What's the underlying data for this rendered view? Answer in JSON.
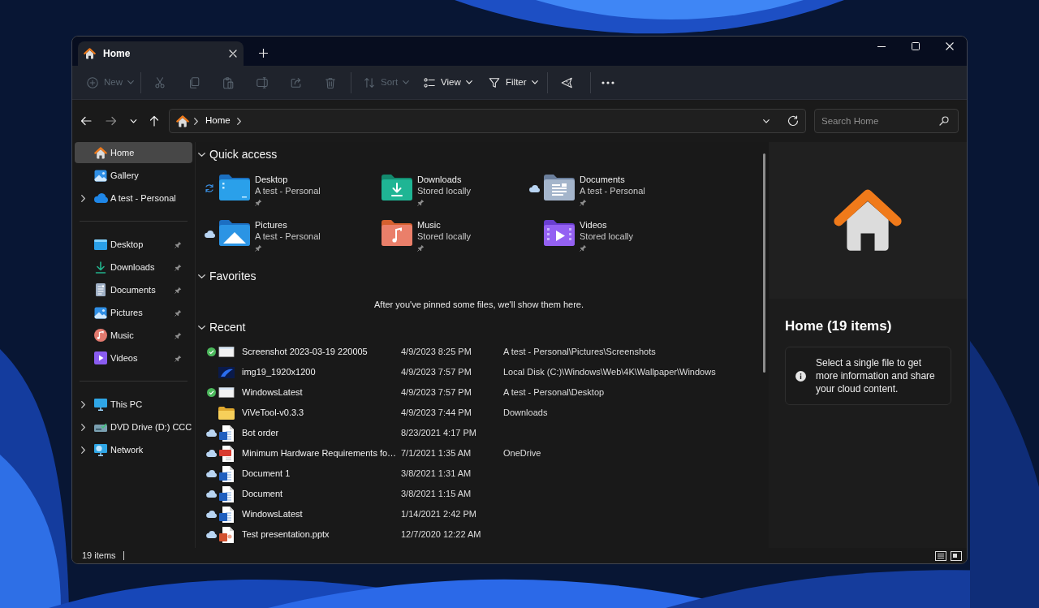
{
  "window": {
    "tabs": [
      {
        "label": "Home",
        "selected": true
      }
    ]
  },
  "toolbar": {
    "new_button": {
      "label": "New",
      "disabled": true
    },
    "cut_button": {
      "disabled": true
    },
    "copy_button": {
      "disabled": true
    },
    "paste_button": {
      "disabled": true
    },
    "rename_button": {
      "disabled": true
    },
    "share_button": {
      "disabled": true
    },
    "delete_button": {
      "disabled": true
    },
    "sort_button": {
      "label": "Sort",
      "disabled": true
    },
    "view_button": {
      "label": "View",
      "disabled": false
    },
    "filter_button": {
      "label": "Filter",
      "disabled": false
    }
  },
  "navigation": {
    "back_button": {
      "disabled": false
    },
    "forward_button": {
      "disabled": true
    },
    "up_button": {
      "disabled": false
    }
  },
  "address_bar": {
    "crumbs": [
      "Home"
    ]
  },
  "search": {
    "placeholder": "Search Home"
  },
  "sidebar": {
    "sections": [
      {
        "items": [
          {
            "label": "Home",
            "kind": "home",
            "selected": true,
            "expandable": false,
            "pinned": false
          },
          {
            "label": "Gallery",
            "kind": "gallery",
            "selected": false,
            "expandable": false,
            "pinned": false
          },
          {
            "label": "A test - Personal",
            "kind": "onedrive",
            "selected": false,
            "expandable": true,
            "pinned": false
          }
        ]
      },
      {
        "items": [
          {
            "label": "Desktop",
            "kind": "desktop",
            "selected": false,
            "expandable": false,
            "pinned": true
          },
          {
            "label": "Downloads",
            "kind": "downloads",
            "selected": false,
            "expandable": false,
            "pinned": true
          },
          {
            "label": "Documents",
            "kind": "documents",
            "selected": false,
            "expandable": false,
            "pinned": true
          },
          {
            "label": "Pictures",
            "kind": "pictures",
            "selected": false,
            "expandable": false,
            "pinned": true
          },
          {
            "label": "Music",
            "kind": "music",
            "selected": false,
            "expandable": false,
            "pinned": true
          },
          {
            "label": "Videos",
            "kind": "videos",
            "selected": false,
            "expandable": false,
            "pinned": true
          }
        ]
      },
      {
        "items": [
          {
            "label": "This PC",
            "kind": "pc",
            "selected": false,
            "expandable": true,
            "pinned": false
          },
          {
            "label": "DVD Drive (D:) CCC",
            "kind": "dvd",
            "selected": false,
            "expandable": true,
            "pinned": false
          },
          {
            "label": "Network",
            "kind": "network",
            "selected": false,
            "expandable": true,
            "pinned": false
          }
        ]
      }
    ]
  },
  "quick_access": {
    "title": "Quick access",
    "expanded": true,
    "items": [
      {
        "name": "Desktop",
        "location": "A test - Personal",
        "kind": "desktop",
        "syncing": true,
        "online_only": false,
        "pinned": true
      },
      {
        "name": "Downloads",
        "location": "Stored locally",
        "kind": "downloads",
        "syncing": false,
        "online_only": false,
        "pinned": true
      },
      {
        "name": "Documents",
        "location": "A test - Personal",
        "kind": "documents",
        "syncing": false,
        "online_only": true,
        "pinned": true
      },
      {
        "name": "Pictures",
        "location": "A test - Personal",
        "kind": "pictures",
        "syncing": false,
        "online_only": true,
        "pinned": true
      },
      {
        "name": "Music",
        "location": "Stored locally",
        "kind": "music",
        "syncing": false,
        "online_only": false,
        "pinned": true
      },
      {
        "name": "Videos",
        "location": "Stored locally",
        "kind": "videos",
        "syncing": false,
        "online_only": false,
        "pinned": true
      }
    ]
  },
  "favorites": {
    "title": "Favorites",
    "expanded": true,
    "message": "After you've pinned some files, we'll show them here."
  },
  "recent": {
    "title": "Recent",
    "expanded": true,
    "rows": [
      {
        "name": "Screenshot 2023-03-19 220005",
        "date": "4/9/2023 8:25 PM",
        "location": "A test - Personal\\Pictures\\Screenshots",
        "kind": "screenshot",
        "synced": true,
        "online_only": false
      },
      {
        "name": "img19_1920x1200",
        "date": "4/9/2023 7:57 PM",
        "location": "Local Disk (C:)\\Windows\\Web\\4K\\Wallpaper\\Windows",
        "kind": "wallpaper",
        "synced": false,
        "online_only": false
      },
      {
        "name": "WindowsLatest",
        "date": "4/9/2023 7:57 PM",
        "location": "A test - Personal\\Desktop",
        "kind": "screenshot",
        "synced": true,
        "online_only": false
      },
      {
        "name": "ViVeTool-v0.3.3",
        "date": "4/9/2023 7:44 PM",
        "location": "Downloads",
        "kind": "folder",
        "synced": false,
        "online_only": false
      },
      {
        "name": "Bot order",
        "date": "8/23/2021 4:17 PM",
        "kind": "word",
        "synced": false,
        "online_only": true
      },
      {
        "name": "Minimum Hardware Requirements fo…",
        "date": "7/1/2021 1:35 AM",
        "location": "OneDrive",
        "kind": "pdf",
        "synced": false,
        "online_only": true
      },
      {
        "name": "Document 1",
        "date": "3/8/2021 1:31 AM",
        "kind": "word",
        "synced": false,
        "online_only": true
      },
      {
        "name": "Document",
        "date": "3/8/2021 1:15 AM",
        "kind": "word",
        "synced": false,
        "online_only": true
      },
      {
        "name": "WindowsLatest",
        "date": "1/14/2021 2:42 PM",
        "kind": "word",
        "synced": false,
        "online_only": true
      },
      {
        "name": "Test presentation.pptx",
        "date": "12/7/2020 12:22 AM",
        "kind": "powerpoint",
        "synced": false,
        "online_only": true
      }
    ]
  },
  "details_pane": {
    "title": "Home (19 items)",
    "info": "Select a single file to get more information and share your cloud content."
  },
  "status_bar": {
    "item_count": "19 items"
  }
}
